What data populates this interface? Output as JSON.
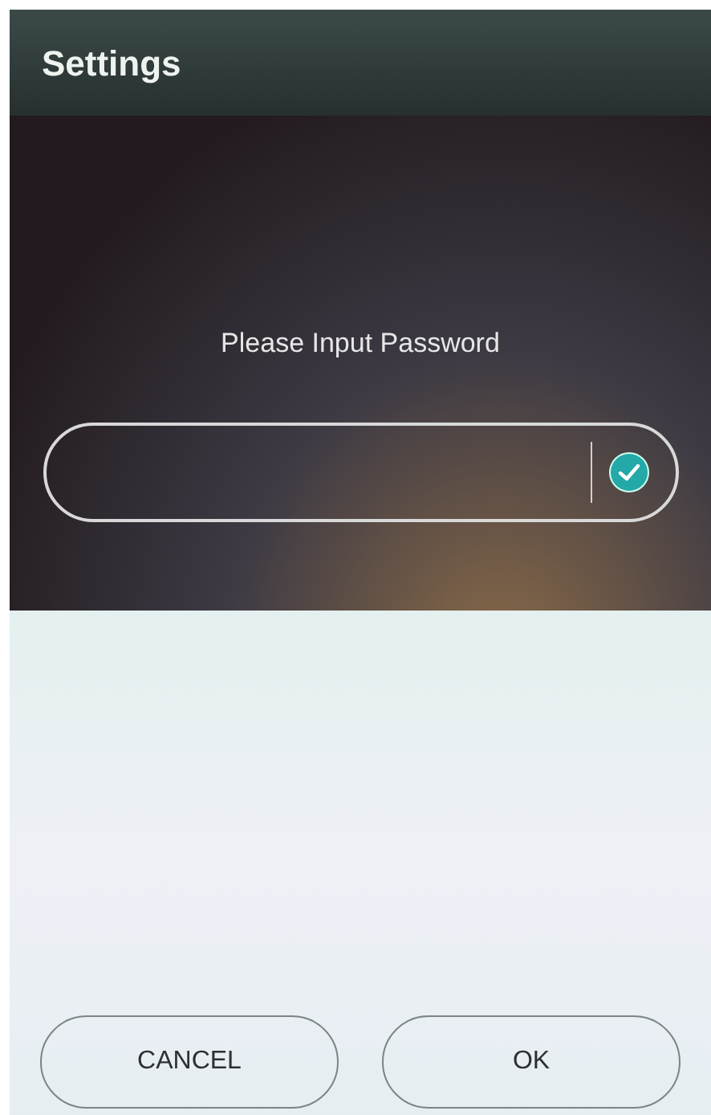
{
  "header": {
    "title": "Settings"
  },
  "password": {
    "prompt": "Please Input Password",
    "confirmed": true
  },
  "buttons": [
    {
      "label": "CANCEL"
    },
    {
      "label": "OK"
    }
  ]
}
